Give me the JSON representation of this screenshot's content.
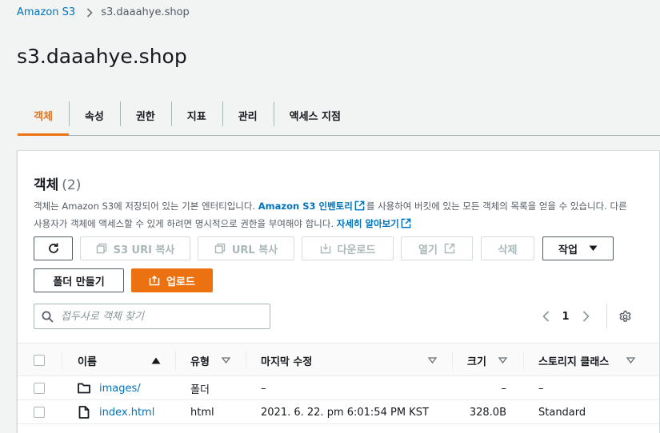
{
  "breadcrumb": {
    "root": "Amazon S3",
    "current": "s3.daaahye.shop"
  },
  "page_title": "s3.daaahye.shop",
  "tabs": [
    {
      "label": "객체",
      "active": true
    },
    {
      "label": "속성"
    },
    {
      "label": "권한"
    },
    {
      "label": "지표"
    },
    {
      "label": "관리"
    },
    {
      "label": "액세스 지점"
    }
  ],
  "objects": {
    "heading": "객체",
    "count": "(2)",
    "desc_part1": "객체는 Amazon S3에 저장되어 있는 기본 엔터티입니다. ",
    "desc_link1": "Amazon S3 인벤토리",
    "desc_part2": "를 사용하여 버킷에 있는 모든 객체의 목록을 얻을 수 있습니다. 다른 사용자가 객체에 액세스할 수 있게 하려면 명시적으로 권한을 부여해야 합니다. ",
    "desc_link2": "자세히 알아보기"
  },
  "toolbar": {
    "copy_s3_uri": "S3 URI 복사",
    "copy_url": "URL 복사",
    "download": "다운로드",
    "open": "열기",
    "delete": "삭제",
    "actions": "작업",
    "create_folder": "폴더 만들기",
    "upload": "업로드"
  },
  "search": {
    "placeholder": "접두사로 객체 찾기",
    "value": ""
  },
  "pagination": {
    "page": "1"
  },
  "table": {
    "columns": {
      "name": "이름",
      "type": "유형",
      "modified": "마지막 수정",
      "size": "크기",
      "storage_class": "스토리지 클래스"
    },
    "rows": [
      {
        "icon": "folder-icon",
        "name": "images/",
        "type": "폴더",
        "modified": "–",
        "size": "–",
        "storage_class": "–"
      },
      {
        "icon": "file-icon",
        "name": "index.html",
        "type": "html",
        "modified": "2021. 6. 22. pm 6:01:54 PM KST",
        "size": "328.0B",
        "storage_class": "Standard"
      }
    ]
  },
  "colors": {
    "accent": "#ec7211",
    "link": "#0073bb",
    "disabled": "#aab7b8"
  }
}
